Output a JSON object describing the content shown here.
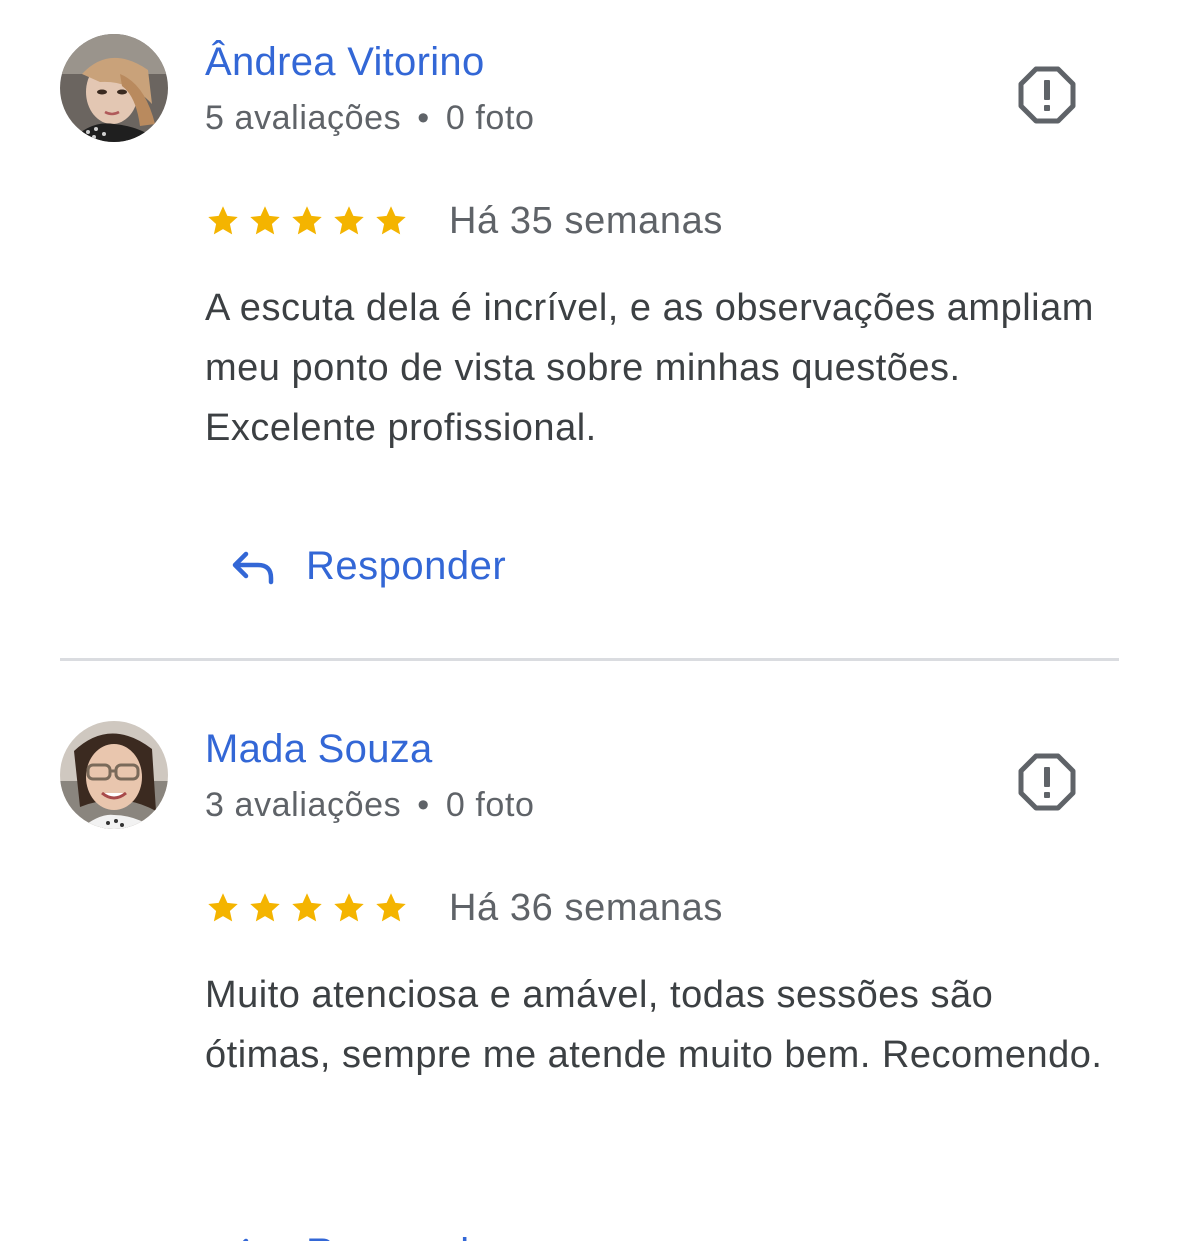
{
  "colors": {
    "link": "#3367d6",
    "star": "#f4b400",
    "meta_text": "#5f6368",
    "body_text": "#3c4043",
    "divider": "#dadce0"
  },
  "reviews": [
    {
      "name": "Ândrea Vitorino",
      "review_count": "5 avaliações",
      "separator": "•",
      "photo_count": "0 foto",
      "rating": 5,
      "date": "Há 35 semanas",
      "text": "A escuta dela é incrível, e as observações ampliam meu ponto de vista sobre minhas questões. Excelente profissional.",
      "reply_label": "Responder",
      "avatar_icon": "user-photo",
      "flag_icon": "report-octagon-icon"
    },
    {
      "name": "Mada Souza",
      "review_count": "3 avaliações",
      "separator": "•",
      "photo_count": "0 foto",
      "rating": 5,
      "date": "Há 36 semanas",
      "text": "Muito atenciosa e amável, todas sessões são ótimas, sempre me atende muito bem. Recomendo.",
      "reply_label": "Responder",
      "avatar_icon": "user-photo",
      "flag_icon": "report-octagon-icon"
    }
  ]
}
